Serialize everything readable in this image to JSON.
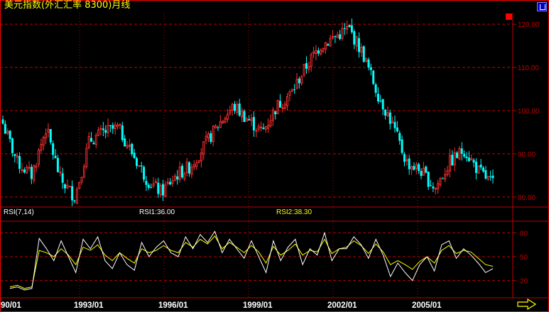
{
  "window": {
    "title": "美元指数(外汇汇率 8300)月线"
  },
  "colors": {
    "up_candle": "#ff3030",
    "down_candle": "#00ffff",
    "grid": "#c00000",
    "rsi1": "#ffffff",
    "rsi2": "#ffff00",
    "axis_labels": "#c00000"
  },
  "icons": [
    "window-restore-icon",
    "scroll-right-arrow-icon"
  ],
  "rsi_panel": {
    "label": "RSI(7,14)",
    "rsi1_text": "RSI1:36.00",
    "rsi2_text": "RSI2:38.30"
  },
  "chart_data": [
    {
      "type": "candlestick",
      "title": "美元指数(外汇汇率 8300)月线",
      "x_tick_labels": [
        "90/01",
        "1993/01",
        "1996/01",
        "1999/01",
        "2002/01",
        "2005/01"
      ],
      "y_tick_labels": [
        "120.00",
        "110.00",
        "100.00",
        "90.00",
        "80.00"
      ],
      "ylim": [
        78,
        122
      ],
      "grid": true,
      "series": [
        {
          "x": [
            "1990/01",
            "1990/07",
            "1991/01",
            "1991/07",
            "1992/01",
            "1992/07",
            "1993/01",
            "1993/07",
            "1994/01",
            "1994/07",
            "1995/01",
            "1995/07",
            "1996/01",
            "1996/07",
            "1997/01",
            "1997/07",
            "1998/01",
            "1998/07",
            "1999/01",
            "1999/07",
            "2000/01",
            "2000/07",
            "2001/01",
            "2001/07",
            "2002/01",
            "2002/07",
            "2003/01",
            "2003/07",
            "2004/01",
            "2004/07",
            "2005/01",
            "2005/07",
            "2006/01",
            "2006/07",
            "2007/01"
          ],
          "values": [
            97,
            88,
            85,
            96,
            84,
            80,
            93,
            95,
            96,
            90,
            84,
            81,
            85,
            87,
            92,
            97,
            101,
            98,
            95,
            101,
            104,
            110,
            115,
            117,
            119,
            113,
            104,
            97,
            88,
            86,
            82,
            88,
            91,
            86,
            83
          ]
        }
      ]
    },
    {
      "type": "line",
      "title": "RSI(7,14)",
      "y_tick_labels": [
        "80",
        "50",
        "20"
      ],
      "ylim": [
        0,
        92
      ],
      "grid": true,
      "series": [
        {
          "name": "RSI1:36.00",
          "values": [
            10,
            12,
            8,
            10,
            73,
            60,
            45,
            70,
            50,
            30,
            72,
            60,
            75,
            45,
            35,
            55,
            40,
            33,
            68,
            50,
            62,
            70,
            55,
            50,
            75,
            60,
            78,
            68,
            82,
            55,
            72,
            60,
            48,
            70,
            50,
            30,
            70,
            45,
            62,
            72,
            40,
            60,
            52,
            80,
            45,
            60,
            60,
            75,
            65,
            48,
            72,
            52,
            25,
            42,
            30,
            20,
            40,
            50,
            32,
            65,
            70,
            48,
            60,
            52,
            42,
            30,
            35
          ]
        },
        {
          "name": "RSI2:38.30",
          "values": [
            12,
            14,
            10,
            12,
            58,
            55,
            50,
            60,
            52,
            40,
            62,
            58,
            65,
            52,
            45,
            55,
            48,
            42,
            60,
            55,
            58,
            64,
            58,
            55,
            68,
            62,
            72,
            66,
            76,
            60,
            68,
            62,
            55,
            64,
            56,
            42,
            63,
            52,
            58,
            66,
            52,
            58,
            56,
            72,
            54,
            60,
            62,
            70,
            64,
            54,
            66,
            56,
            40,
            45,
            40,
            34,
            44,
            50,
            42,
            58,
            64,
            54,
            58,
            56,
            48,
            40,
            38
          ]
        }
      ]
    }
  ]
}
